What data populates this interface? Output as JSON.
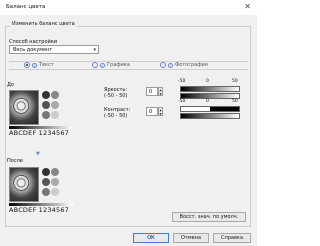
{
  "window": {
    "title": "Баланс цвета"
  },
  "group": {
    "title": "Изменить баланс цвета"
  },
  "method": {
    "label": "Способ настройки",
    "value": "Весь документ"
  },
  "tabs": [
    {
      "label": "Текст",
      "selected": true
    },
    {
      "label": "Графика",
      "selected": false
    },
    {
      "label": "Фотография",
      "selected": false
    }
  ],
  "before": {
    "label": "До",
    "sample_text": "ABCDEF 1234567"
  },
  "after": {
    "label": "После",
    "sample_text": "ABCDEF 1234567"
  },
  "brightness": {
    "label": "Яркость:",
    "range": "(-50 - 50)",
    "value": "0",
    "scale_min": "-50",
    "scale_mid": "0",
    "scale_max": "50"
  },
  "contrast": {
    "label": "Контраст:",
    "range": "(-50 - 50)",
    "value": "0",
    "scale_min": "-50",
    "scale_mid": "0",
    "scale_max": "50"
  },
  "buttons": {
    "reset": "Восст. знач. по умолч.",
    "ok": "ОК",
    "cancel": "Отмена",
    "help": "Справка"
  },
  "colors": {
    "accent": "#3c7fd0"
  }
}
